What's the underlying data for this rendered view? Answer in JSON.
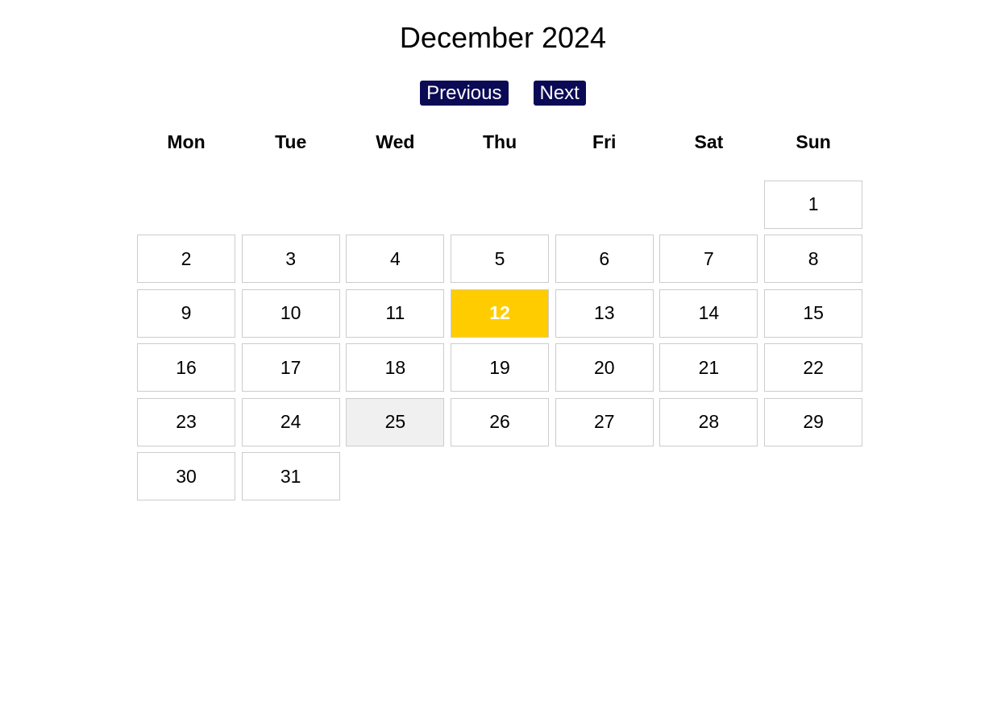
{
  "calendar": {
    "title": "December 2024",
    "first_day_column": 7,
    "weekdays": [
      "Mon",
      "Tue",
      "Wed",
      "Thu",
      "Fri",
      "Sat",
      "Sun"
    ],
    "days": [
      "1",
      "2",
      "3",
      "4",
      "5",
      "6",
      "7",
      "8",
      "9",
      "10",
      "11",
      "12",
      "13",
      "14",
      "15",
      "16",
      "17",
      "18",
      "19",
      "20",
      "21",
      "22",
      "23",
      "24",
      "25",
      "26",
      "27",
      "28",
      "29",
      "30",
      "31"
    ],
    "today": "12",
    "hovered": "25"
  },
  "nav": {
    "previous_label": "Previous",
    "next_label": "Next"
  },
  "colors": {
    "nav_button_bg": "#0b0a55",
    "nav_button_text": "#ffffff",
    "today_bg": "#ffcc00",
    "hover_bg": "#f0f0f0",
    "border": "#cccccc"
  }
}
